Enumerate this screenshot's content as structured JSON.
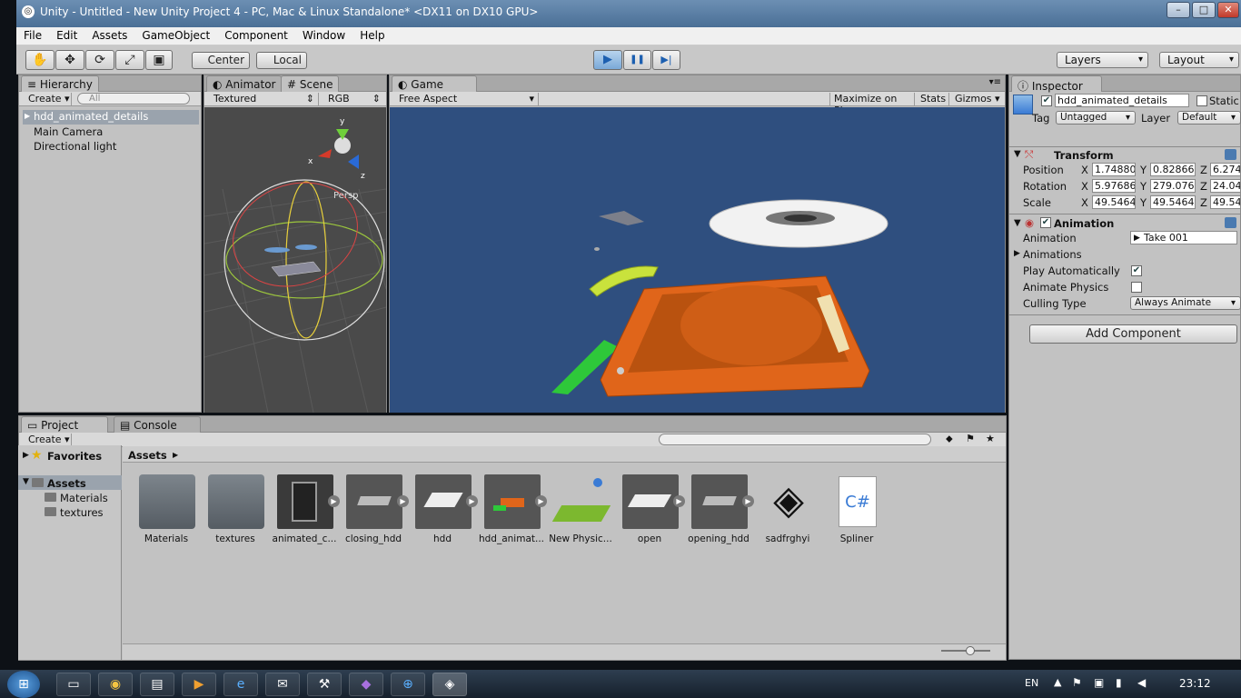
{
  "window": {
    "title": "Unity - Untitled - New Unity Project 4 - PC, Mac & Linux Standalone* <DX11 on DX10 GPU>",
    "minimize": "–",
    "maximize": "□",
    "close": "✕"
  },
  "menu": [
    "File",
    "Edit",
    "Assets",
    "GameObject",
    "Component",
    "Window",
    "Help"
  ],
  "toolbar": {
    "tools": [
      "✋",
      "✥",
      "⟳",
      "⤢",
      "▣"
    ],
    "pivot": "Center",
    "space": "Local",
    "play": "▶",
    "pause": "❚❚",
    "step": "▶|",
    "layers": "Layers",
    "layout": "Layout"
  },
  "hierarchy": {
    "tab": "Hierarchy",
    "create": "Create",
    "search_placeholder": "All",
    "items": [
      "hdd_animated_details",
      "Main Camera",
      "Directional light"
    ]
  },
  "scene": {
    "animator_tab": "Animator",
    "scene_tab": "Scene",
    "render_mode": "Textured",
    "color_mode": "RGB",
    "persp_label": "Persp",
    "axis_y": "y",
    "axis_x": "x",
    "axis_z": "z"
  },
  "game": {
    "tab": "Game",
    "aspect": "Free Aspect",
    "maximize": "Maximize on Play",
    "stats": "Stats",
    "gizmos": "Gizmos"
  },
  "inspector": {
    "tab": "Inspector",
    "object_name": "hdd_animated_details",
    "static_label": "Static",
    "tag_label": "Tag",
    "tag_value": "Untagged",
    "layer_label": "Layer",
    "layer_value": "Default",
    "transform": {
      "title": "Transform",
      "position_label": "Position",
      "rotation_label": "Rotation",
      "scale_label": "Scale",
      "position": [
        "1.74880",
        "0.82866",
        "6.274"
      ],
      "rotation": [
        "5.97686",
        "279.076",
        "24.04"
      ],
      "scale": [
        "49.5464",
        "49.5464",
        "49.54"
      ]
    },
    "animation": {
      "title": "Animation",
      "animation_label": "Animation",
      "animation_value": "Take 001",
      "animations_label": "Animations",
      "play_auto_label": "Play Automatically",
      "play_auto": true,
      "physics_label": "Animate Physics",
      "physics": false,
      "culling_label": "Culling Type",
      "culling_value": "Always Animate"
    },
    "add_component": "Add Component"
  },
  "project": {
    "project_tab": "Project",
    "console_tab": "Console",
    "create": "Create",
    "favorites": "Favorites",
    "assets_root": "Assets",
    "folders": [
      "Materials",
      "textures"
    ],
    "breadcrumb": "Assets",
    "assets": [
      {
        "label": "Materials",
        "kind": "folder"
      },
      {
        "label": "textures",
        "kind": "folder"
      },
      {
        "label": "animated_c...",
        "kind": "model"
      },
      {
        "label": "closing_hdd",
        "kind": "model"
      },
      {
        "label": "hdd",
        "kind": "model"
      },
      {
        "label": "hdd_animat...",
        "kind": "model"
      },
      {
        "label": "New Physic...",
        "kind": "physics"
      },
      {
        "label": "open",
        "kind": "model"
      },
      {
        "label": "opening_hdd",
        "kind": "model"
      },
      {
        "label": "sadfrghyi",
        "kind": "unity"
      },
      {
        "label": "Spliner",
        "kind": "script"
      }
    ],
    "script_glyph": "C#"
  },
  "taskbar": {
    "lang": "EN",
    "time": "23:12"
  },
  "colors": {
    "game_bg": "#2f4f7f",
    "hdd_orange": "#e0651a",
    "accent_blue": "#3a7bd5"
  }
}
